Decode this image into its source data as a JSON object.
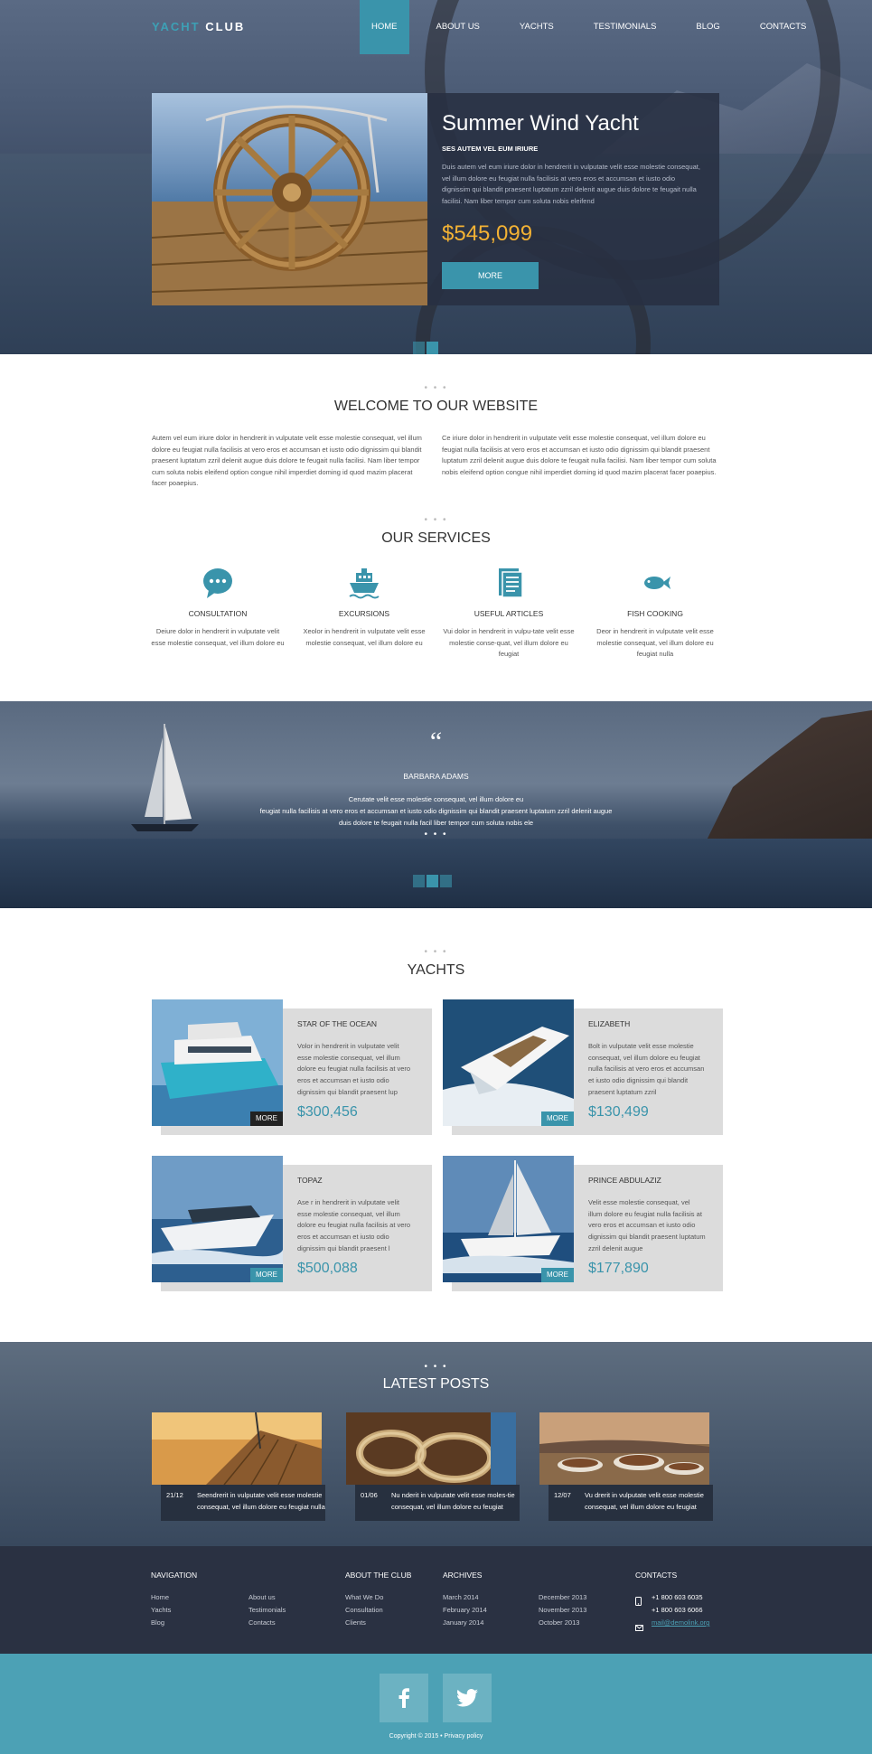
{
  "brand": {
    "part1": "YACHT",
    "part2": "CLUB"
  },
  "nav": [
    {
      "label": "HOME",
      "active": true
    },
    {
      "label": "ABOUT US"
    },
    {
      "label": "YACHTS"
    },
    {
      "label": "TESTIMONIALS"
    },
    {
      "label": "BLOG"
    },
    {
      "label": "CONTACTS"
    }
  ],
  "hero": {
    "title": "Summer Wind Yacht",
    "subtitle": "SES AUTEM VEL EUM IRIURE",
    "text": "Duis autem vel eum iriure dolor in hendrerit in vulputate velit esse molestie consequat, vel illum dolore eu feugiat nulla facilisis at vero eros et accumsan et iusto odio dignissim qui blandit praesent luptatum zzril delenit augue duis dolore te feugait nulla facilisi. Nam liber tempor cum soluta nobis eleifend",
    "price": "$545,099",
    "button": "MORE"
  },
  "welcome": {
    "dots": "• • •",
    "title": "WELCOME TO OUR WEBSITE",
    "col1": "Autem vel eum iriure dolor in hendrerit in vulputate velit esse molestie consequat, vel illum dolore eu feugiat nulla facilisis at vero eros et accumsan et iusto odio dignissim qui blandit praesent luptatum zzril delenit augue duis dolore te feugait nulla facilisi. Nam liber tempor cum soluta nobis eleifend option congue nihil imperdiet doming id quod mazim placerat facer poaepius.",
    "col2": "Ce iriure dolor in hendrerit in vulputate velit esse molestie consequat, vel illum dolore eu feugiat nulla facilisis at vero eros et accumsan et iusto odio dignissim qui blandit praesent luptatum zzril delenit augue duis dolore te feugait nulla facilisi. Nam liber tempor cum soluta nobis eleifend option congue nihil imperdiet doming id quod mazim placerat facer poaepius."
  },
  "services": {
    "title": "OUR SERVICES",
    "items": [
      {
        "icon": "speech-bubble-icon",
        "title": "CONSULTATION",
        "text": "Deiure dolor in hendrerit in vulputate velit esse molestie consequat, vel illum dolore eu"
      },
      {
        "icon": "ship-icon",
        "title": "EXCURSIONS",
        "text": "Xeolor in hendrerit in vulputate velit esse molestie consequat, vel illum dolore eu"
      },
      {
        "icon": "document-icon",
        "title": "USEFUL ARTICLES",
        "text": "Vui  dolor in hendrerit in vulpu-tate velit esse molestie conse-quat, vel illum dolore eu feugiat"
      },
      {
        "icon": "fish-icon",
        "title": "FISH COOKING",
        "text": "Deor in hendrerit in vulputate velit esse molestie consequat, vel illum dolore eu feugiat nulla"
      }
    ]
  },
  "testimonial": {
    "quote_mark": "“",
    "name": "BARBARA ADAMS",
    "line1": "Cerutate velit esse molestie consequat, vel illum dolore eu",
    "line2": "feugiat nulla facilisis at vero eros et accumsan et iusto odio dignissim qui blandit praesent luptatum zzril delenit augue",
    "line3": "duis dolore te feugait nulla facil liber tempor cum soluta nobis ele"
  },
  "yachts": {
    "title": "YACHTS",
    "items": [
      {
        "name": "STAR OF THE OCEAN",
        "text": "Volor in hendrerit in vulputate velit esse molestie consequat, vel illum dolore eu feugiat nulla facilisis at vero eros et accumsan et iusto odio dignissim qui blandit praesent lup",
        "price": "$300,456",
        "button": "MORE"
      },
      {
        "name": "ELIZABETH",
        "text": "Bolt in vulputate velit esse molestie consequat, vel illum dolore eu feugiat nulla facilisis at vero eros et accumsan et iusto odio dignissim qui blandit praesent luptatum zzril",
        "price": "$130,499",
        "button": "MORE"
      },
      {
        "name": "TOPAZ",
        "text": "Ase r in hendrerit in vulputate velit esse molestie consequat, vel illum dolore eu feugiat nulla facilisis at vero eros et accumsan et iusto odio dignissim qui blandit praesent l",
        "price": "$500,088",
        "button": "MORE"
      },
      {
        "name": "PRINCE ABDULAZIZ",
        "text": "Velit esse molestie consequat, vel illum dolore eu feugiat nulla facilisis at vero eros et accumsan et iusto odio dignissim qui blandit praesent luptatum zzril delenit augue",
        "price": "$177,890",
        "button": "MORE"
      }
    ]
  },
  "posts": {
    "title": "LATEST POSTS",
    "items": [
      {
        "date": "21/12",
        "text": "Seendrerit in vulputate velit esse molestie consequat, vel illum dolore eu feugiat nulla"
      },
      {
        "date": "01/06",
        "text": "Nu nderit in vulputate velit esse moles-tie consequat, vel illum dolore eu feugiat"
      },
      {
        "date": "12/07",
        "text": "Vu drerit in vulputate velit esse molestie consequat, vel illum dolore eu feugiat"
      }
    ]
  },
  "footer": {
    "navigation": {
      "title": "NAVIGATION",
      "col1": [
        "Home",
        "Yachts",
        "Blog"
      ],
      "col2": [
        "About us",
        "Testimonials",
        "Contacts"
      ]
    },
    "about": {
      "title": "ABOUT THE CLUB",
      "items": [
        "What We Do",
        "Consultation",
        "Clients"
      ]
    },
    "archives": {
      "title": "ARCHIVES",
      "col1": [
        "March 2014",
        "February 2014",
        "January 2014"
      ],
      "col2": [
        "December 2013",
        "November 2013",
        "October 2013"
      ]
    },
    "contacts": {
      "title": "CONTACTS",
      "phone1": "+1 800 603 6035",
      "phone2": "+1 800 603 6066",
      "email": "mail@demolink.org"
    },
    "copyright": "Copyright © 2015 • Privacy policy"
  },
  "colors": {
    "accent": "#3a94ab",
    "price_gold": "#f3b234",
    "footer_bg": "#2a3142",
    "social_bg": "#4ca1b5"
  }
}
